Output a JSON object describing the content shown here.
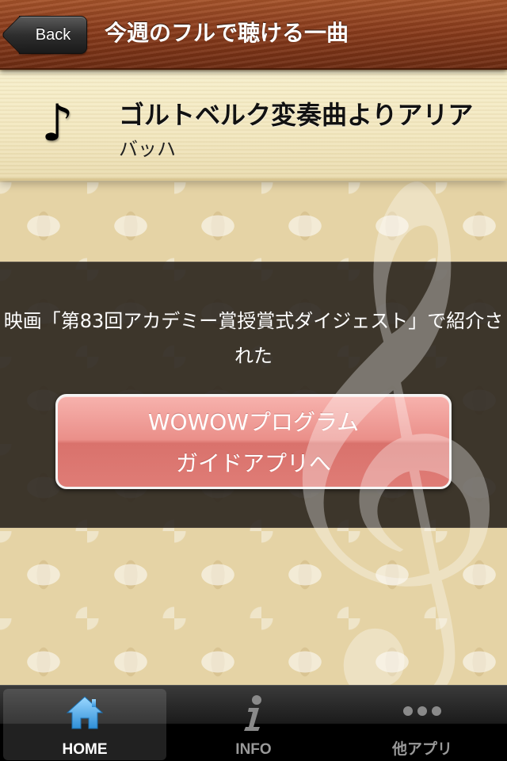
{
  "nav": {
    "back_label": "Back",
    "title": "今週のフルで聴ける一曲"
  },
  "song": {
    "icon": "music-note-icon",
    "title": "ゴルトベルク変奏曲よりアリア",
    "artist": "バッハ"
  },
  "banner": {
    "text": "映画「第83回アカデミー賞授賞式ダイジェスト」で紹介された",
    "button_line1": "WOWOWプログラム",
    "button_line2": "ガイドアプリへ"
  },
  "tabs": [
    {
      "label": "HOME",
      "icon": "home-icon",
      "active": true
    },
    {
      "label": "INFO",
      "icon": "info-icon",
      "active": false
    },
    {
      "label": "他アプリ",
      "icon": "more-icon",
      "active": false
    }
  ],
  "colors": {
    "accent_active": "#5fb5ea",
    "button": "#e58a84"
  }
}
